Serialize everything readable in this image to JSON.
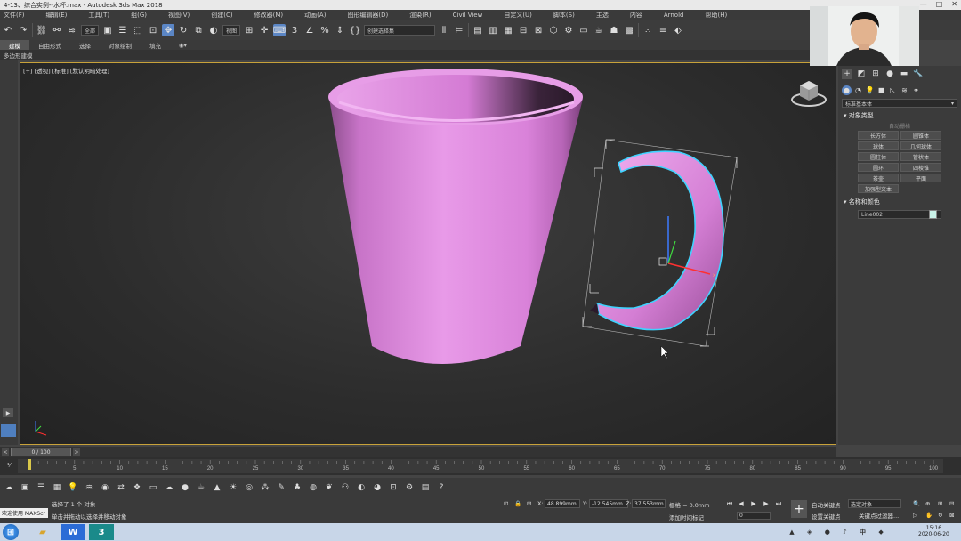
{
  "window": {
    "title": "4-13、综合实例--水杯.max - Autodesk 3ds Max 2018",
    "controls": [
      "—",
      "□",
      "✕"
    ]
  },
  "menu": [
    "文件(F)",
    "编辑(E)",
    "工具(T)",
    "组(G)",
    "视图(V)",
    "创建(C)",
    "修改器(M)",
    "动画(A)",
    "图形编辑器(D)",
    "渲染(R)",
    "Civil View",
    "自定义(U)",
    "脚本(S)",
    "主选",
    "内容",
    "Arnold",
    "帮助(H)"
  ],
  "toolbar": {
    "selection_filter": "全部",
    "reference_coord": "视图",
    "named_selection": "创建选择集"
  },
  "ribbon": {
    "tabs": [
      "建模",
      "自由形式",
      "选择",
      "对象绘制",
      "填充"
    ],
    "active_tab": "建模",
    "sub_label": "多边形建模"
  },
  "viewport": {
    "label": "[+] [透视] [标准] [默认明暗处理]",
    "accent_border": "#c8a23a",
    "cup_color": "#e48fe4",
    "handle_outline": "#3fd3ff"
  },
  "command_panel": {
    "dropdown": "标准基本体",
    "object_type_title": "对象类型",
    "autogrid": "自动栅格",
    "object_buttons": [
      "长方体",
      "圆锥体",
      "球体",
      "几何球体",
      "圆柱体",
      "管状体",
      "圆环",
      "四棱锥",
      "茶壶",
      "平面"
    ],
    "extra_button": "加强型文本",
    "name_color_title": "名称和颜色",
    "object_name": "Line002",
    "object_color": "#c9f2e8"
  },
  "time_slider": {
    "label": "0 / 100",
    "prev": "<",
    "next": ">"
  },
  "track": {
    "ticks": [
      "0",
      "5",
      "10",
      "15",
      "20",
      "25",
      "30",
      "35",
      "40",
      "45",
      "50",
      "55",
      "60",
      "65",
      "70",
      "75",
      "80",
      "85",
      "90",
      "95",
      "100"
    ]
  },
  "status": {
    "maxscript": "欢迎使用 MAXScr",
    "line1": "选择了 1 个 对象",
    "line2": "单击并拖动以选择并移动对象",
    "x_label": "X:",
    "x_value": "48.899mm",
    "y_label": "Y:",
    "y_value": "-12.545mm",
    "z_label": "Z:",
    "z_value": "37.553mm",
    "grid": "栅格 = 0.0mm",
    "add_time_tag": "添加时间标记",
    "frame": "0",
    "auto_key": "自动关键点",
    "set_key": "设置关键点",
    "selection_set": "选定对象",
    "key_filters": "关键点过滤器..."
  },
  "taskbar": {
    "time": "15:16",
    "date": "2020-06-20"
  }
}
